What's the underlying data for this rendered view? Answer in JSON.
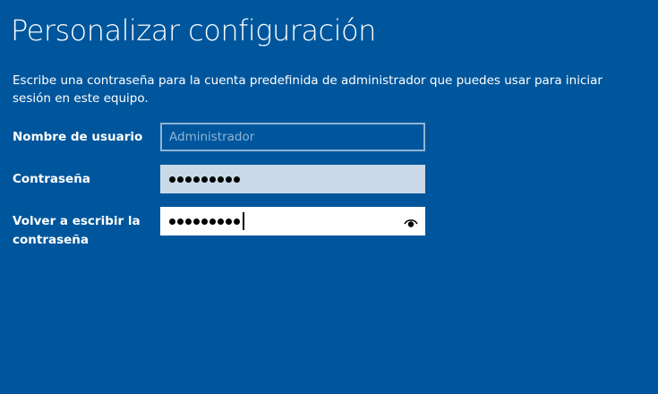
{
  "title": "Personalizar configuración",
  "description": "Escribe una contraseña para la cuenta predefinida de administrador que puedes usar para iniciar sesión en este equipo.",
  "fields": {
    "username": {
      "label": "Nombre de usuario",
      "placeholder": "Administrador"
    },
    "password": {
      "label": "Contraseña",
      "masked_length": 9
    },
    "confirm": {
      "label": "Volver a escribir la contraseña",
      "masked_length": 9,
      "reveal_icon": "eye-icon"
    }
  },
  "colors": {
    "background": "#00569c",
    "active_field": "#ffffff",
    "filled_field": "#c9d9e8",
    "empty_field_border": "#8fb4d6"
  }
}
